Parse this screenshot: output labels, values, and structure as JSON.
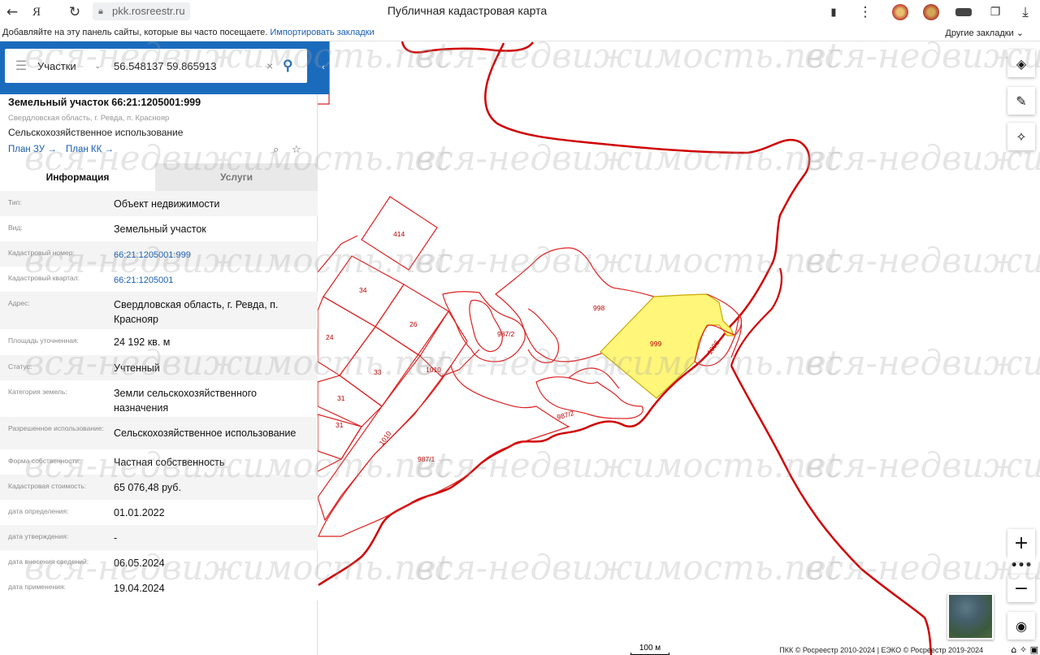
{
  "browser": {
    "url": "pkk.rosreestr.ru",
    "page_title": "Публичная кадастровая карта",
    "bookmarks_hint": "Добавляйте на эту панель сайты, которые вы часто посещаете.",
    "bookmarks_import": "Импортировать закладки",
    "bookmarks_other": "Другие закладки"
  },
  "search": {
    "type": "Участки",
    "query": "56.548137 59.865913"
  },
  "object": {
    "title": "Земельный участок 66:21:1205001:999",
    "address_short": "Свердловская область, г. Ревда, п. Краснояр",
    "use": "Сельскохозяйственное использование",
    "plan_zu": "План ЗУ →",
    "plan_kk": "План КК →"
  },
  "tabs": {
    "info": "Информация",
    "services": "Услуги"
  },
  "info_rows": [
    {
      "key": "Тип:",
      "value": "Объект недвижимости"
    },
    {
      "key": "Вид:",
      "value": "Земельный участок"
    },
    {
      "key": "Кадастровый номер:",
      "value": "66:21:1205001:999"
    },
    {
      "key": "Кадастровый квартал:",
      "value": "66:21:1205001"
    },
    {
      "key": "Адрес:",
      "value": "Свердловская область, г. Ревда, п. Краснояр"
    },
    {
      "key": "Площадь уточненная:",
      "value": "24 192 кв. м"
    },
    {
      "key": "Статус:",
      "value": "Учтенный"
    },
    {
      "key": "Категория земель:",
      "value": "Земли сельскохозяйственного назначения"
    },
    {
      "key": "Разрешенное использование:",
      "value": "Сельскохозяйственное использование"
    },
    {
      "key": "Форма собственности:",
      "value": "Частная собственность"
    },
    {
      "key": "Кадастровая стоимость:",
      "value": "65 076,48 руб."
    },
    {
      "key": "дата определения:",
      "value": "01.01.2022"
    },
    {
      "key": "дата утверждения:",
      "value": "-"
    },
    {
      "key": "дата внесения сведений:",
      "value": "06.05.2024"
    },
    {
      "key": "дата применения:",
      "value": "19.04.2024"
    }
  ],
  "map": {
    "plot_labels": [
      "414",
      "34",
      "26",
      "24",
      "33",
      "1010",
      "31",
      "31",
      "1010",
      "987/1",
      "987/2",
      "987/2",
      "998",
      "999",
      "1006"
    ],
    "scale_label": "100 м",
    "attribution": "ПКК © Росреестр 2010-2024 | ЕЭКО © Росреестр 2019-2024",
    "watermark": "вся-недвижимость.net",
    "selected_color": "#fff67a",
    "border_color": "#d00000"
  }
}
